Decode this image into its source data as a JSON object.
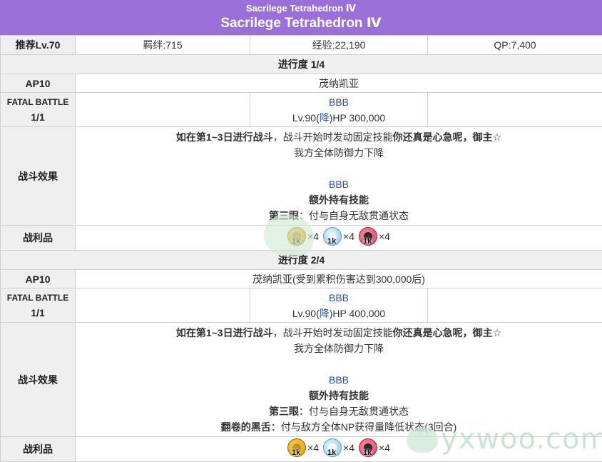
{
  "title": {
    "small": "Sacrilege Tetrahedron Ⅳ",
    "big": "Sacrilege Tetrahedron Ⅳ"
  },
  "info_row": {
    "level": "推荐Lv.70",
    "bond": "羁绊:715",
    "exp": "经验:22,190",
    "qp": "QP:7,400"
  },
  "stages": [
    {
      "progress": "进行度 1/4",
      "ap_label": "AP10",
      "enemy_name": "茂纳凯亚",
      "fatal_label_1": "FATAL BATTLE",
      "fatal_label_2": "1/1",
      "boss_name": "BBB",
      "boss_lv": "Lv.90(",
      "boss_class": "降",
      "boss_hp": ")HP 300,000",
      "effect_label": "战斗效果",
      "effect_line1_a": "如在第1~3日进行战斗",
      "effect_line1_b": "，战斗开始时发动固定技能",
      "effect_line1_c": "你还真是心急呢，御主☆",
      "effect_line2": "我方全体防御力下降",
      "effect_boss": "BBB",
      "effect_extra_title": "额外持有技能",
      "effect_skill1_name": "第三眼",
      "effect_skill1_desc": "：付与自身无敌贯通状态",
      "drops_label": "战利品",
      "drops": [
        {
          "icon": "qp-bag-icon",
          "badge": "1k",
          "qty": "×4"
        },
        {
          "icon": "shell-icon",
          "badge": "1k",
          "qty": "×4"
        },
        {
          "icon": "fang-icon",
          "badge": "1k",
          "qty": "×4"
        }
      ]
    },
    {
      "progress": "进行度 2/4",
      "ap_label": "AP10",
      "enemy_name": "茂纳凯亚(受到累积伤害达到300,000后)",
      "fatal_label_1": "FATAL BATTLE",
      "fatal_label_2": "1/1",
      "boss_name": "BBB",
      "boss_lv": "Lv.90(",
      "boss_class": "降",
      "boss_hp": ")HP 400,000",
      "effect_label": "战斗效果",
      "effect_line1_a": "如在第1~3日进行战斗",
      "effect_line1_b": "，战斗开始时发动固定技能",
      "effect_line1_c": "你还真是心急呢，御主☆",
      "effect_line2": "我方全体防御力下降",
      "effect_boss": "BBB",
      "effect_extra_title": "额外持有技能",
      "effect_skill1_name": "第三眼",
      "effect_skill1_desc": "：付与自身无敌贯通状态",
      "effect_skill2_name": "翻卷的黑舌",
      "effect_skill2_desc": "：付与敌方全体NP获得量降低状态(3回合)",
      "drops_label": "战利品",
      "drops": [
        {
          "icon": "qp-bag-icon",
          "badge": "1k",
          "qty": "×4"
        },
        {
          "icon": "shell-icon",
          "badge": "1k",
          "qty": "×4"
        },
        {
          "icon": "fang-icon",
          "badge": "1k",
          "qty": "×4"
        }
      ]
    }
  ],
  "watermark": "yxwoo.com",
  "colors": {
    "title_bg": "#9a6fd8",
    "header_bg": "#efefef",
    "link_blue": "#2b4f9e"
  }
}
